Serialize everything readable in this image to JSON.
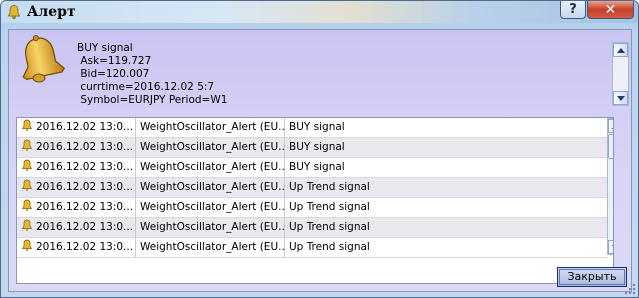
{
  "window": {
    "title": "Алерт",
    "help_label": "?",
    "close_label": "✕",
    "title_icon": "bell-icon"
  },
  "message": {
    "icon": "bell-icon",
    "lines": [
      "BUY signal",
      " Ask=119.727",
      " Bid=120.007",
      " currtime=2016.12.02 5:7",
      " Symbol=EURJPY Period=W1"
    ]
  },
  "alerts": [
    {
      "time": "2016.12.02 13:0...",
      "expert": "WeightOscillator_Alert (EU...",
      "message": "BUY signal"
    },
    {
      "time": "2016.12.02 13:0...",
      "expert": "WeightOscillator_Alert (EU...",
      "message": "BUY signal"
    },
    {
      "time": "2016.12.02 13:0...",
      "expert": "WeightOscillator_Alert (EU...",
      "message": "BUY signal"
    },
    {
      "time": "2016.12.02 13:0...",
      "expert": "WeightOscillator_Alert (EU...",
      "message": "Up Trend signal"
    },
    {
      "time": "2016.12.02 13:0...",
      "expert": "WeightOscillator_Alert (EU...",
      "message": "Up Trend signal"
    },
    {
      "time": "2016.12.02 13:0...",
      "expert": "WeightOscillator_Alert (EU...",
      "message": "Up Trend signal"
    },
    {
      "time": "2016.12.02 13:0...",
      "expert": "WeightOscillator_Alert (EU...",
      "message": "Up Trend signal"
    }
  ],
  "buttons": {
    "close_label": "Закрыть"
  }
}
